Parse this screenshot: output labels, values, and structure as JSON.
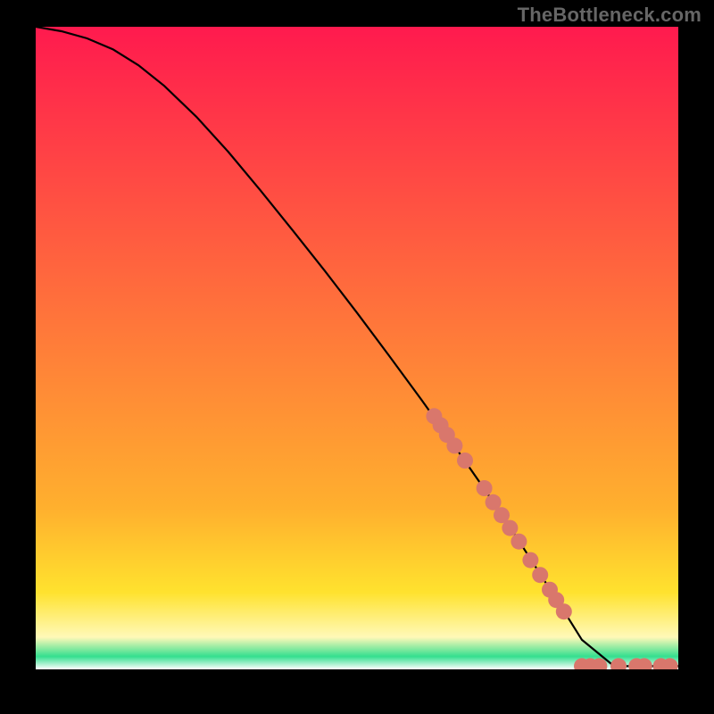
{
  "watermark": "TheBottleneck.com",
  "colors": {
    "black": "#000000",
    "curve": "#000000",
    "dot": "#d9776c",
    "grad_top": "#ff1a4e",
    "grad_mid1": "#ffb02e",
    "grad_mid2": "#ffe22e",
    "grad_pale": "#fff9b8",
    "grad_green": "#34df8f",
    "grad_bottom": "#ffffff"
  },
  "chart_data": {
    "type": "line",
    "title": "",
    "xlabel": "",
    "ylabel": "",
    "xlim": [
      0,
      100
    ],
    "ylim": [
      0,
      100
    ],
    "series": [
      {
        "name": "curve",
        "x": [
          0,
          4,
          8,
          12,
          16,
          20,
          25,
          30,
          35,
          40,
          45,
          50,
          55,
          60,
          65,
          70,
          75,
          80,
          82,
          85,
          90,
          95,
          100
        ],
        "y": [
          100,
          99.3,
          98.2,
          96.5,
          94.0,
          90.8,
          86.0,
          80.5,
          74.5,
          68.3,
          62.0,
          55.5,
          48.8,
          42.0,
          35.0,
          27.8,
          20.3,
          12.5,
          9.4,
          4.6,
          0.5,
          0.5,
          0.5
        ]
      }
    ],
    "dots": [
      {
        "x": 62.0,
        "y": 39.4
      },
      {
        "x": 63.0,
        "y": 38.0
      },
      {
        "x": 64.0,
        "y": 36.5
      },
      {
        "x": 65.2,
        "y": 34.8
      },
      {
        "x": 66.8,
        "y": 32.5
      },
      {
        "x": 69.8,
        "y": 28.2
      },
      {
        "x": 71.2,
        "y": 26.0
      },
      {
        "x": 72.5,
        "y": 24.0
      },
      {
        "x": 73.8,
        "y": 22.0
      },
      {
        "x": 75.2,
        "y": 19.9
      },
      {
        "x": 77.0,
        "y": 17.0
      },
      {
        "x": 78.5,
        "y": 14.7
      },
      {
        "x": 80.0,
        "y": 12.4
      },
      {
        "x": 81.0,
        "y": 10.8
      },
      {
        "x": 82.2,
        "y": 9.0
      },
      {
        "x": 85.0,
        "y": 0.5
      },
      {
        "x": 86.3,
        "y": 0.5
      },
      {
        "x": 87.7,
        "y": 0.5
      },
      {
        "x": 90.7,
        "y": 0.5
      },
      {
        "x": 93.5,
        "y": 0.5
      },
      {
        "x": 94.7,
        "y": 0.5
      },
      {
        "x": 97.3,
        "y": 0.5
      },
      {
        "x": 98.7,
        "y": 0.5
      }
    ],
    "gradient_bands": [
      {
        "y0": 100,
        "y1": 25,
        "from": "grad_top",
        "to": "grad_mid1"
      },
      {
        "y0": 25,
        "y1": 12,
        "from": "grad_mid1",
        "to": "grad_mid2"
      },
      {
        "y0": 12,
        "y1": 5,
        "from": "grad_mid2",
        "to": "grad_pale"
      },
      {
        "y0": 5,
        "y1": 2,
        "from": "grad_pale",
        "to": "grad_green"
      },
      {
        "y0": 2,
        "y1": 0,
        "from": "grad_green",
        "to": "grad_bottom"
      }
    ]
  }
}
